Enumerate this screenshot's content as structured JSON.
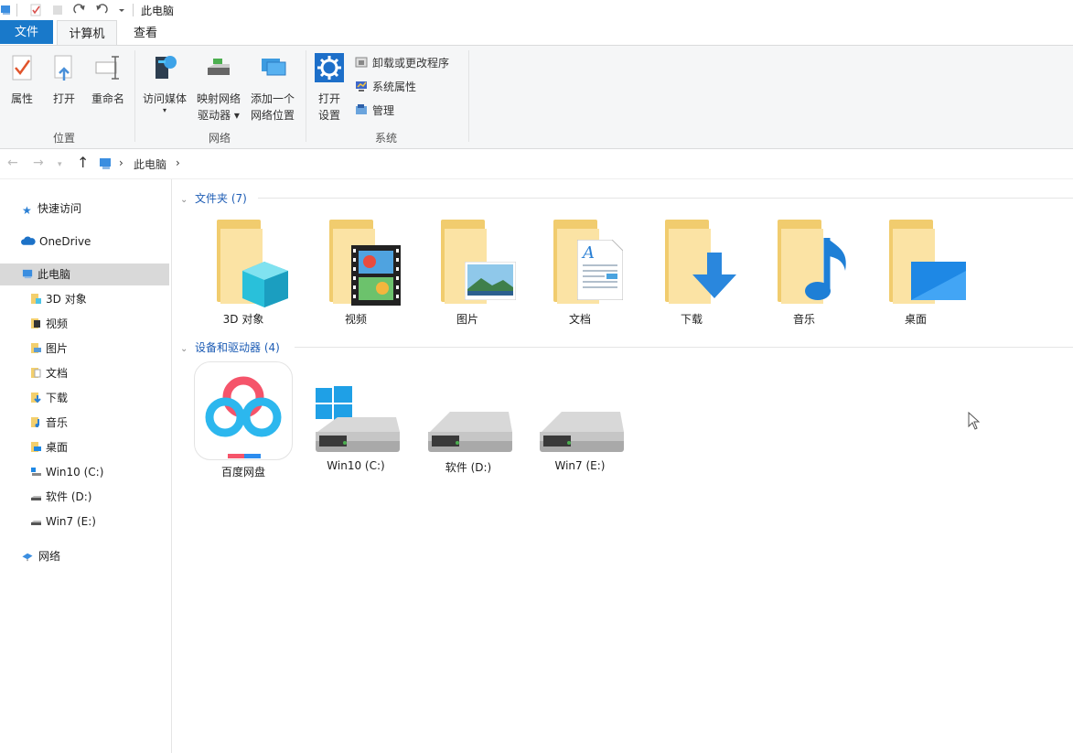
{
  "window": {
    "title": "此电脑"
  },
  "tabs": {
    "file": "文件",
    "computer": "计算机",
    "view": "查看"
  },
  "ribbon": {
    "location": {
      "group": "位置",
      "properties": "属性",
      "open": "打开",
      "rename": "重命名"
    },
    "network": {
      "group": "网络",
      "media": "访问媒体",
      "map1": "映射网络",
      "map2": "驱动器",
      "add1": "添加一个",
      "add2": "网络位置"
    },
    "system": {
      "group": "系统",
      "settings1": "打开",
      "settings2": "设置",
      "uninstall": "卸载或更改程序",
      "sysprops": "系统属性",
      "manage": "管理"
    }
  },
  "address": {
    "location": "此电脑"
  },
  "sidebar": {
    "quick": "快速访问",
    "onedrive": "OneDrive",
    "thispc": "此电脑",
    "items": [
      "3D 对象",
      "视频",
      "图片",
      "文档",
      "下载",
      "音乐",
      "桌面",
      "Win10 (C:)",
      "软件 (D:)",
      "Win7 (E:)"
    ],
    "network": "网络"
  },
  "folders": {
    "header": "文件夹 (7)",
    "items": [
      "3D 对象",
      "视频",
      "图片",
      "文档",
      "下载",
      "音乐",
      "桌面"
    ]
  },
  "devices": {
    "header": "设备和驱动器 (4)",
    "items": [
      "百度网盘",
      "Win10 (C:)",
      "软件 (D:)",
      "Win7 (E:)"
    ]
  },
  "colors": {
    "accent": "#1979ca",
    "folder": "#f6d37a",
    "selection": "#d9d9d9",
    "section": "#1e5db5"
  }
}
